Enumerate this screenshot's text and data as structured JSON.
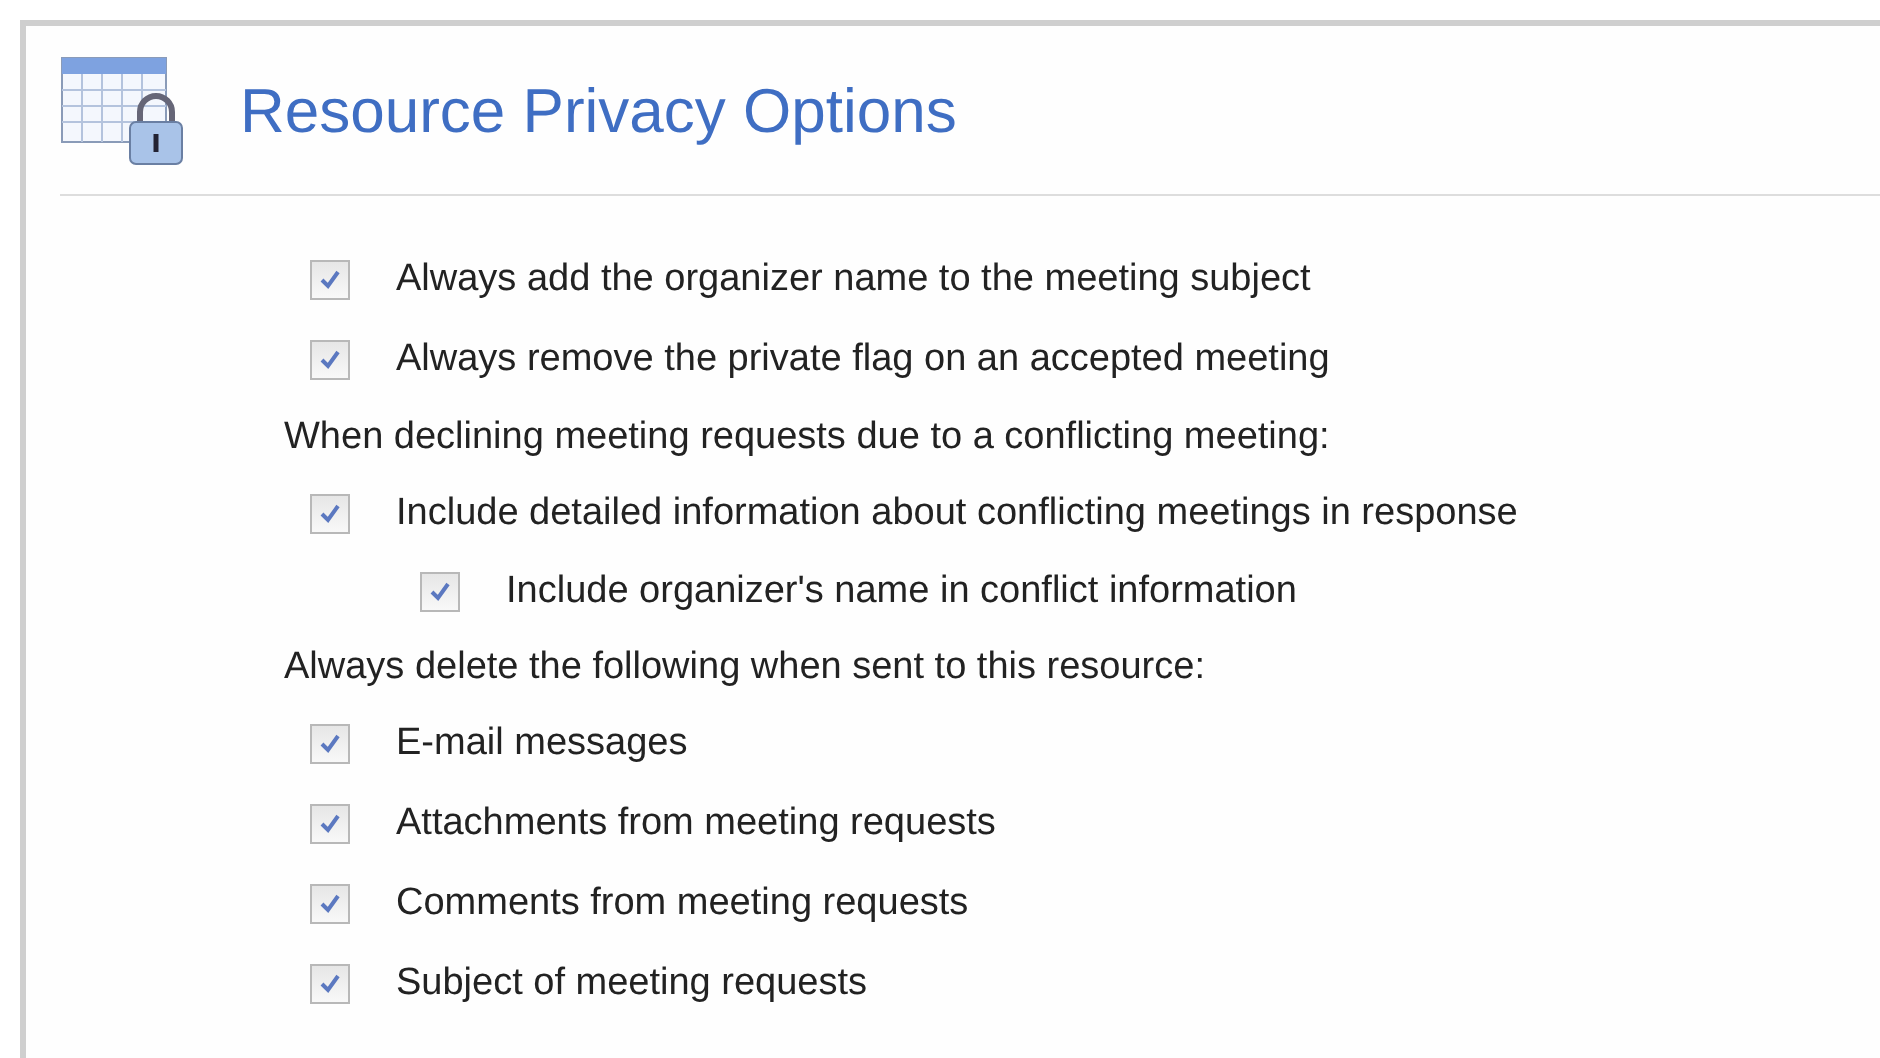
{
  "title": "Resource Privacy Options",
  "items": [
    {
      "kind": "checkbox",
      "label": "Always add the organizer name to the meeting subject",
      "checked": true
    },
    {
      "kind": "checkbox",
      "label": "Always remove the private flag on an accepted meeting",
      "checked": true
    },
    {
      "kind": "heading",
      "label": "When declining meeting requests due to a conflicting meeting:"
    },
    {
      "kind": "checkbox",
      "label": "Include detailed information about conflicting meetings in response",
      "checked": true,
      "children": [
        {
          "label": "Include organizer's name in conflict information",
          "checked": true
        }
      ]
    },
    {
      "kind": "heading",
      "label": "Always delete the following when sent to this resource:"
    },
    {
      "kind": "checkbox",
      "label": "E-mail messages",
      "checked": true
    },
    {
      "kind": "checkbox",
      "label": "Attachments from meeting requests",
      "checked": true
    },
    {
      "kind": "checkbox",
      "label": "Comments from meeting requests",
      "checked": true
    },
    {
      "kind": "checkbox",
      "label": "Subject of meeting requests",
      "checked": true
    }
  ]
}
